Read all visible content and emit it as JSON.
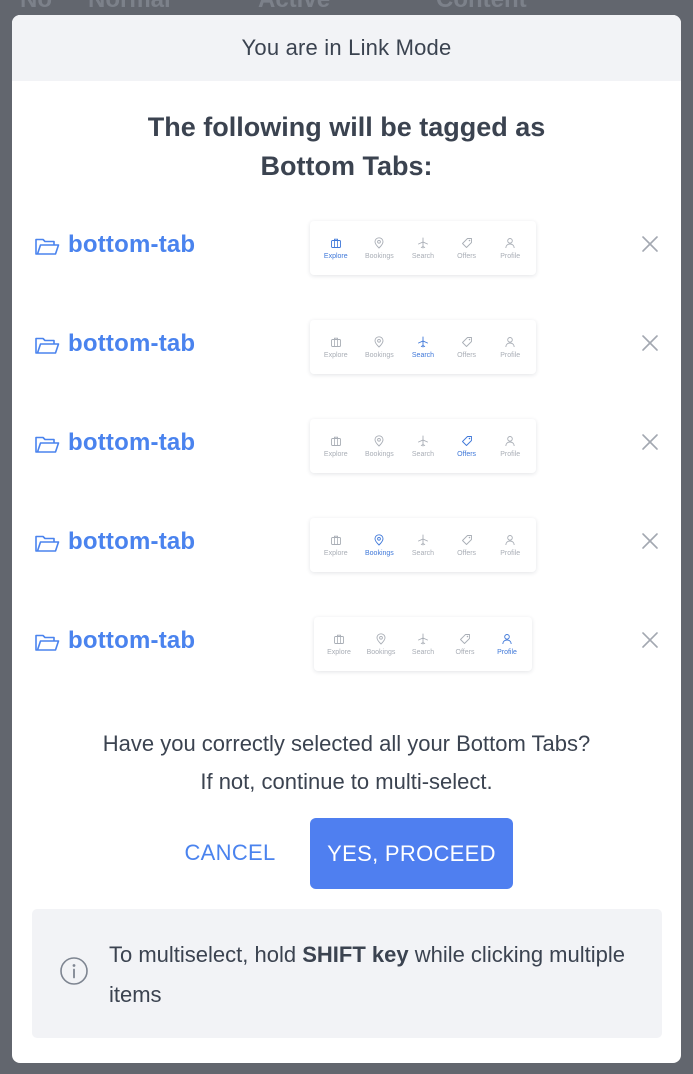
{
  "background": {
    "headers": [
      "No",
      "Normal",
      "Active",
      "Content"
    ]
  },
  "modal": {
    "header": "You are in Link Mode",
    "title_line1": "The following will be tagged as",
    "title_line2": "Bottom Tabs:",
    "items": [
      {
        "label": "bottom-tab",
        "active_tab": "Explore"
      },
      {
        "label": "bottom-tab",
        "active_tab": "Search"
      },
      {
        "label": "bottom-tab",
        "active_tab": "Offers"
      },
      {
        "label": "bottom-tab",
        "active_tab": "Bookings"
      },
      {
        "label": "bottom-tab",
        "active_tab": "Profile"
      }
    ],
    "preview_tabs": [
      "Explore",
      "Bookings",
      "Search",
      "Offers",
      "Profile"
    ],
    "question_line1": "Have you correctly selected all your Bottom Tabs?",
    "question_line2": "If not, continue to multi-select.",
    "cancel_label": "CANCEL",
    "proceed_label": "YES, PROCEED",
    "tip_before": "To multiselect, hold ",
    "tip_bold": "SHIFT key",
    "tip_after": " while clicking multiple items"
  },
  "colors": {
    "accent": "#4a83ee",
    "primary_button": "#4f7ff0",
    "overlay": "#62666e"
  },
  "icons": [
    "folder-icon",
    "close-icon",
    "info-icon",
    "briefcase-icon",
    "location-pin-icon",
    "plane-icon",
    "tag-icon",
    "user-icon"
  ]
}
